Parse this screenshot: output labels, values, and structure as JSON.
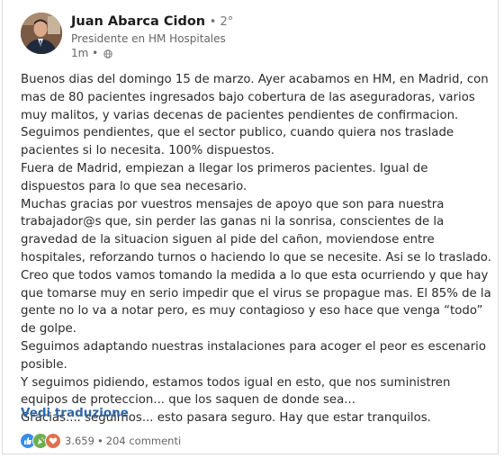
{
  "author": {
    "name": "Juan Abarca Cidon",
    "degree": "• 2°",
    "headline": "Presidente en HM Hospitales",
    "time": "1m •"
  },
  "post": {
    "paragraphs": [
      "Buenos dias del domingo 15 de marzo. Ayer acabamos en HM, en Madrid, con mas de 80 pacientes ingresados bajo cobertura de las aseguradoras, varios muy malitos, y varias decenas de pacientes pendientes de confirmacion. Seguimos pendientes, que el sector publico, cuando quiera nos traslade pacientes si lo necesita. 100% dispuestos.",
      "Fuera de Madrid, empiezan a llegar los primeros pacientes. Igual de dispuestos para lo que sea necesario.",
      "Muchas gracias por vuestros mensajes de apoyo que son para nuestra trabajador@s que, sin perder las ganas ni la sonrisa, conscientes de la gravedad de la situacion siguen al pide del cañon, moviendose entre hospitales, reforzando turnos o haciendo lo que se necesite. Asi se lo traslado.",
      "Creo que todos vamos tomando la medida a lo que esta ocurriendo y que hay que tomarse muy en serio impedir que el virus se propague mas. El 85% de la gente no lo va a notar pero, es muy contagioso y eso hace que venga “todo” de golpe.",
      "Seguimos adaptando nuestras instalaciones para acoger el peor es escenario posible.",
      "Y seguimos pidiendo, estamos todos igual en esto, que nos suministren equipos de proteccion... que los saquen de donde sea...",
      "Gracias.... seguimos... esto pasara seguro. Hay que estar tranquilos."
    ],
    "translate_label": "Vedi traduzione"
  },
  "social": {
    "reactions": [
      "like-icon",
      "celebrate-icon",
      "love-icon"
    ],
    "reaction_count": "3.659",
    "separator": "•",
    "comments": "204 commenti"
  },
  "colors": {
    "link": "#2c67a8",
    "like": "#378fe9",
    "celebrate": "#6dae4f",
    "love": "#df704d"
  }
}
